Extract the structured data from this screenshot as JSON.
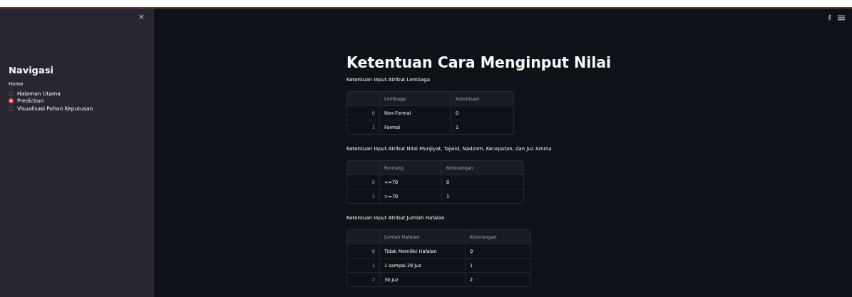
{
  "sidebar": {
    "close": "×",
    "title": "Navigasi",
    "radio_group": {
      "label": "Home",
      "options": [
        {
          "label": "Halaman Utama",
          "selected": false
        },
        {
          "label": "Prediction",
          "selected": true
        },
        {
          "label": "Visualisasi Pohon Keputusan",
          "selected": false
        }
      ]
    }
  },
  "main": {
    "title": "Ketentuan Cara Menginput Nilai",
    "sections": [
      {
        "label": "Ketentuan Input Atribut Lembaga",
        "table": {
          "columns": [
            "Lembaga",
            "Ketentuan"
          ],
          "rows": [
            {
              "index": "0",
              "cells": [
                "Non-Formal",
                "0"
              ]
            },
            {
              "index": "1",
              "cells": [
                "Formal",
                "1"
              ]
            }
          ]
        }
      },
      {
        "label": "Ketentuan Input Atribut Nilai Munjiyat, Tajwid, Nadzom, Kecepatan, dan Juz Amma",
        "table": {
          "columns": [
            "Rentang",
            "Keterangan"
          ],
          "rows": [
            {
              "index": "0",
              "cells": [
                "<=70",
                "0"
              ]
            },
            {
              "index": "1",
              "cells": [
                ">=70",
                "1"
              ]
            }
          ]
        }
      },
      {
        "label": "Ketentuan Input Atribut Jumlah Hafalan",
        "table": {
          "columns": [
            "Jumlah Hafalan",
            "Keterangan"
          ],
          "rows": [
            {
              "index": "0",
              "cells": [
                "Tidak Memiliki Hafalan",
                "0"
              ]
            },
            {
              "index": "1",
              "cells": [
                "1 sampai 29 Juz",
                "1"
              ]
            },
            {
              "index": "2",
              "cells": [
                "30 Juz",
                "2"
              ]
            }
          ]
        }
      }
    ]
  }
}
